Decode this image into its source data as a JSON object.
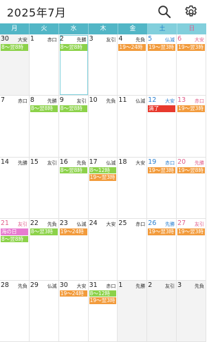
{
  "header": {
    "title": "2025年7月",
    "search_icon": "search-icon",
    "settings_icon": "gear-icon"
  },
  "weekdays": [
    "月",
    "火",
    "水",
    "木",
    "金",
    "土",
    "日"
  ],
  "colors": {
    "green": "#8cd24a",
    "orange": "#f29b3c",
    "red": "#e83a2e",
    "pink": "#e77bd0",
    "header": "#52b6c6"
  },
  "weeks": [
    [
      {
        "d": "30",
        "r": "大安",
        "out": true,
        "ev": [
          {
            "t": "8～翌8時",
            "c": "green"
          }
        ]
      },
      {
        "d": "1",
        "r": "赤口",
        "ev": []
      },
      {
        "d": "2",
        "r": "先勝",
        "selected": true,
        "ev": [
          {
            "t": "8～翌8時",
            "c": "green"
          }
        ]
      },
      {
        "d": "3",
        "r": "友引",
        "ev": []
      },
      {
        "d": "4",
        "r": "先負",
        "ev": [
          {
            "t": "19～24時",
            "c": "orange"
          }
        ]
      },
      {
        "d": "5",
        "r": "仏滅",
        "sat": true,
        "ev": [
          {
            "t": "19～翌3時",
            "c": "orange"
          }
        ]
      },
      {
        "d": "6",
        "r": "大安",
        "sun": true,
        "ev": [
          {
            "t": "19～翌3時",
            "c": "orange"
          }
        ]
      }
    ],
    [
      {
        "d": "7",
        "r": "赤口",
        "ev": []
      },
      {
        "d": "8",
        "r": "先勝",
        "ev": [
          {
            "t": "8～翌8時",
            "c": "green"
          }
        ]
      },
      {
        "d": "9",
        "r": "友引",
        "ev": [
          {
            "t": "8～翌8時",
            "c": "green"
          }
        ]
      },
      {
        "d": "10",
        "r": "先負",
        "ev": []
      },
      {
        "d": "11",
        "r": "仏滅",
        "ev": []
      },
      {
        "d": "12",
        "r": "大安",
        "sat": true,
        "today": true,
        "ev": [
          {
            "t": "満了",
            "c": "red"
          }
        ]
      },
      {
        "d": "13",
        "r": "赤口",
        "sun": true,
        "ev": [
          {
            "t": "19～翌3時",
            "c": "orange"
          }
        ]
      }
    ],
    [
      {
        "d": "14",
        "r": "先勝",
        "ev": []
      },
      {
        "d": "15",
        "r": "友引",
        "ev": []
      },
      {
        "d": "16",
        "r": "先負",
        "ev": [
          {
            "t": "8～翌8時",
            "c": "green"
          }
        ]
      },
      {
        "d": "17",
        "r": "仏滅",
        "ev": [
          {
            "t": "8～12時",
            "c": "green"
          },
          {
            "t": "19～翌3時",
            "c": "orange"
          }
        ]
      },
      {
        "d": "18",
        "r": "大安",
        "ev": []
      },
      {
        "d": "19",
        "r": "赤口",
        "sat": true,
        "ev": [
          {
            "t": "19～翌3時",
            "c": "orange"
          }
        ]
      },
      {
        "d": "20",
        "r": "先勝",
        "sun": true,
        "ev": [
          {
            "t": "19～翌8時",
            "c": "orange"
          }
        ]
      }
    ],
    [
      {
        "d": "21",
        "r": "友引",
        "hol": true,
        "ev": [
          {
            "t": "海の日",
            "c": "pink"
          },
          {
            "t": "8～翌8時",
            "c": "green"
          }
        ]
      },
      {
        "d": "22",
        "r": "先負",
        "ev": [
          {
            "t": "8～翌3時",
            "c": "green"
          }
        ]
      },
      {
        "d": "23",
        "r": "仏滅",
        "ev": [
          {
            "t": "19～24時",
            "c": "orange"
          }
        ]
      },
      {
        "d": "24",
        "r": "大安",
        "ev": []
      },
      {
        "d": "25",
        "r": "赤口",
        "ev": []
      },
      {
        "d": "26",
        "r": "先勝",
        "sat": true,
        "ev": [
          {
            "t": "19～翌3時",
            "c": "orange"
          }
        ]
      },
      {
        "d": "27",
        "r": "友引",
        "sun": true,
        "ev": [
          {
            "t": "19～翌3時",
            "c": "orange"
          }
        ]
      }
    ],
    [
      {
        "d": "28",
        "r": "先負",
        "ev": []
      },
      {
        "d": "29",
        "r": "仏滅",
        "ev": []
      },
      {
        "d": "30",
        "r": "大安",
        "ev": [
          {
            "t": "19～24時",
            "c": "orange"
          }
        ]
      },
      {
        "d": "31",
        "r": "赤口",
        "ev": [
          {
            "t": "8～12時",
            "c": "green"
          },
          {
            "t": "19～翌3時",
            "c": "orange"
          }
        ]
      },
      {
        "d": "1",
        "r": "先勝",
        "out": true,
        "ev": []
      },
      {
        "d": "2",
        "r": "友引",
        "out": true,
        "ev": []
      },
      {
        "d": "3",
        "r": "先負",
        "out": true,
        "ev": []
      }
    ]
  ]
}
